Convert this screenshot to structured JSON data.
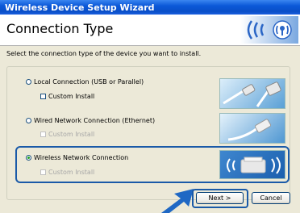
{
  "window": {
    "title": "Wireless Device Setup Wizard"
  },
  "header": {
    "heading": "Connection Type",
    "logo_icon": "wireless-signal-logo-icon"
  },
  "instruction": "Select the connection type of the device you want to install.",
  "options": [
    {
      "label": "Local Connection (USB or Parallel)",
      "selected": false,
      "custom_install_label": "Custom Install",
      "custom_install_enabled": true,
      "image": "usb-parallel-cable"
    },
    {
      "label": "Wired Network Connection (Ethernet)",
      "selected": false,
      "custom_install_label": "Custom Install",
      "custom_install_enabled": false,
      "image": "ethernet-cable"
    },
    {
      "label": "Wireless Network Connection",
      "selected": true,
      "custom_install_label": "Custom Install",
      "custom_install_enabled": false,
      "image": "wireless-printer"
    }
  ],
  "buttons": {
    "next": "Next >",
    "cancel": "Cancel"
  },
  "colors": {
    "highlight": "#1a5aa8",
    "titlebar": "#0b58d8",
    "arrow": "#1f68c4"
  }
}
